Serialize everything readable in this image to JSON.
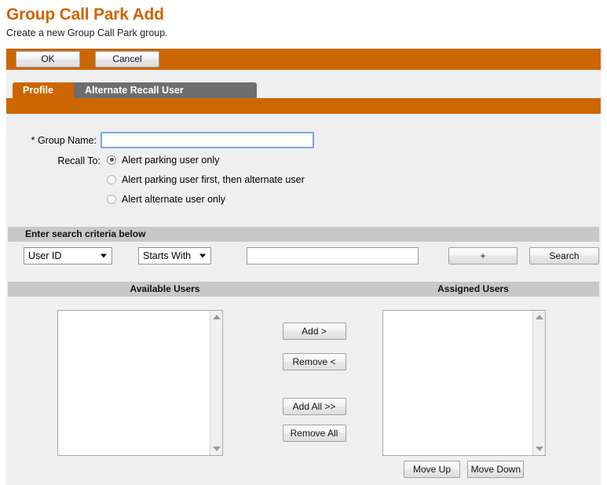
{
  "header": {
    "title": "Group Call Park Add",
    "subtitle": "Create a new Group Call Park group."
  },
  "action_bar": {
    "ok_label": "OK",
    "cancel_label": "Cancel"
  },
  "tabs": [
    {
      "label": "Profile",
      "active": true
    },
    {
      "label": "Alternate Recall User",
      "active": false
    }
  ],
  "form": {
    "group_name_label": "* Group Name:",
    "group_name_value": "",
    "recall_to_label": "Recall To:",
    "recall_options": [
      {
        "label": "Alert parking user only",
        "selected": true
      },
      {
        "label": "Alert parking user first, then alternate user",
        "selected": false
      },
      {
        "label": "Alert alternate user only",
        "selected": false
      }
    ]
  },
  "search": {
    "section_title": "Enter search criteria below",
    "field_select_value": "User ID",
    "mode_select_value": "Starts With",
    "text_value": "",
    "add_criteria_label": "+",
    "search_label": "Search"
  },
  "users": {
    "available_title": "Available Users",
    "assigned_title": "Assigned Users",
    "available_items": [],
    "assigned_items": [],
    "add_label": "Add >",
    "remove_label": "Remove <",
    "add_all_label": "Add All >>",
    "remove_all_label": "Remove All",
    "move_up_label": "Move Up",
    "move_down_label": "Move Down"
  },
  "colors": {
    "accent_orange": "#cc6600",
    "tab_inactive_gray": "#6e6e6e",
    "section_bar_gray": "#c8c8c8",
    "body_gray": "#efefef",
    "focus_blue": "#7ba7e0"
  }
}
